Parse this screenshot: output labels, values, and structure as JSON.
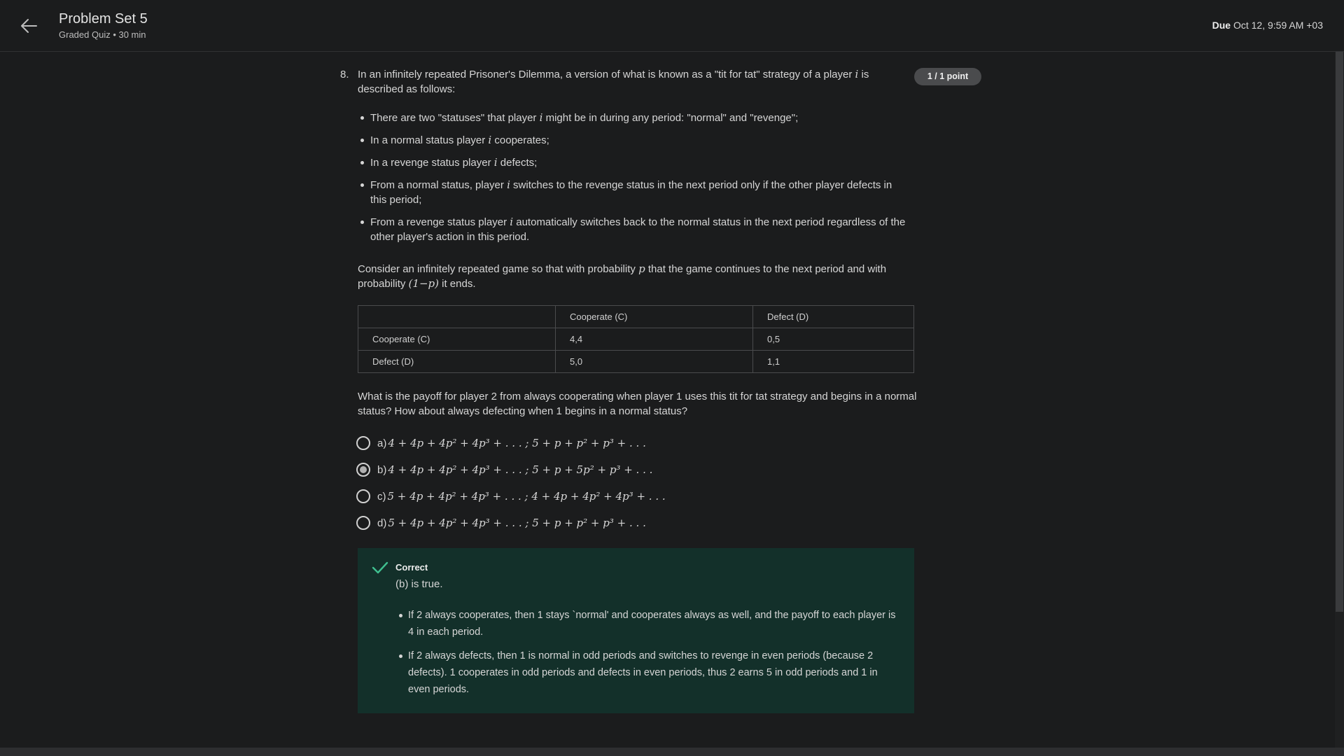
{
  "header": {
    "title": "Problem Set 5",
    "subtitle": "Graded Quiz • 30 min",
    "due_label": "Due",
    "due_value": "Oct 12, 9:59 AM +03",
    "back_icon": "arrow-left-icon"
  },
  "question": {
    "number": "8.",
    "points": "1 / 1 point",
    "intro_before": "In an infinitely repeated Prisoner's Dilemma, a version of what is known as a \"tit for tat\" strategy of a player ",
    "intro_var": "i",
    "intro_after": " is described as follows:",
    "bullets": [
      {
        "before": "There are two \"statuses\" that player ",
        "var": "i",
        "after": " might be in during any period: \"normal\" and \"revenge\";"
      },
      {
        "before": "In a normal status player ",
        "var": "i",
        "after": " cooperates;"
      },
      {
        "before": "In a revenge status player ",
        "var": "i",
        "after": " defects;"
      },
      {
        "before": "From a normal status, player ",
        "var": "i",
        "after": " switches to the revenge status in the next period only if the other player defects in this period;"
      },
      {
        "before": "From a revenge status player ",
        "var": "i",
        "after": " automatically switches back to the normal status in the next period regardless of the other player's action in this period."
      }
    ],
    "consider_before": "Consider an infinitely repeated game so that with probability ",
    "consider_var": "p",
    "consider_mid": " that the game continues to the next period and with probability ",
    "consider_expr": "(1−p)",
    "consider_after": " it ends.",
    "table": {
      "headers": [
        "",
        "Cooperate (C)",
        "Defect (D)"
      ],
      "rows": [
        [
          "Cooperate (C)",
          "4,4",
          "0,5"
        ],
        [
          "Defect (D)",
          "5,0",
          "1,1"
        ]
      ]
    },
    "prompt": "What is the payoff for player 2 from always cooperating when player 1 uses this tit for tat strategy and begins in a normal status? How about always defecting when 1 begins in a normal status?",
    "options": [
      {
        "letter": "a)",
        "math": "4 + 4p + 4p² + 4p³ + . . . ; 5 + p + p² + p³ + . . .",
        "selected": false
      },
      {
        "letter": "b)",
        "math": "4 + 4p + 4p² + 4p³ + . . . ; 5 + p + 5p² + p³ + . . .",
        "selected": true
      },
      {
        "letter": "c)",
        "math": "5 + 4p + 4p² + 4p³ + . . . ; 4 + 4p + 4p² + 4p³ + . . .",
        "selected": false
      },
      {
        "letter": "d)",
        "math": "5 + 4p + 4p² + 4p³ + . . . ; 5 + p + p² + p³ + . . .",
        "selected": false
      }
    ]
  },
  "feedback": {
    "icon": "check-icon",
    "title": "Correct",
    "subtitle": "(b) is true.",
    "bullets": [
      "If 2 always cooperates, then 1 stays `normal' and cooperates always as well, and the payoff to each player is 4 in each period.",
      "If 2 always defects, then 1 is normal in odd periods and switches to revenge in even periods (because 2 defects). 1 cooperates in odd periods and defects in even periods, thus 2 earns 5 in odd periods and 1 in even periods."
    ]
  },
  "colors": {
    "background": "#1b1c1d",
    "feedback_bg": "#13302a",
    "check": "#3fbf8f",
    "badge": "#4a4b4d"
  }
}
